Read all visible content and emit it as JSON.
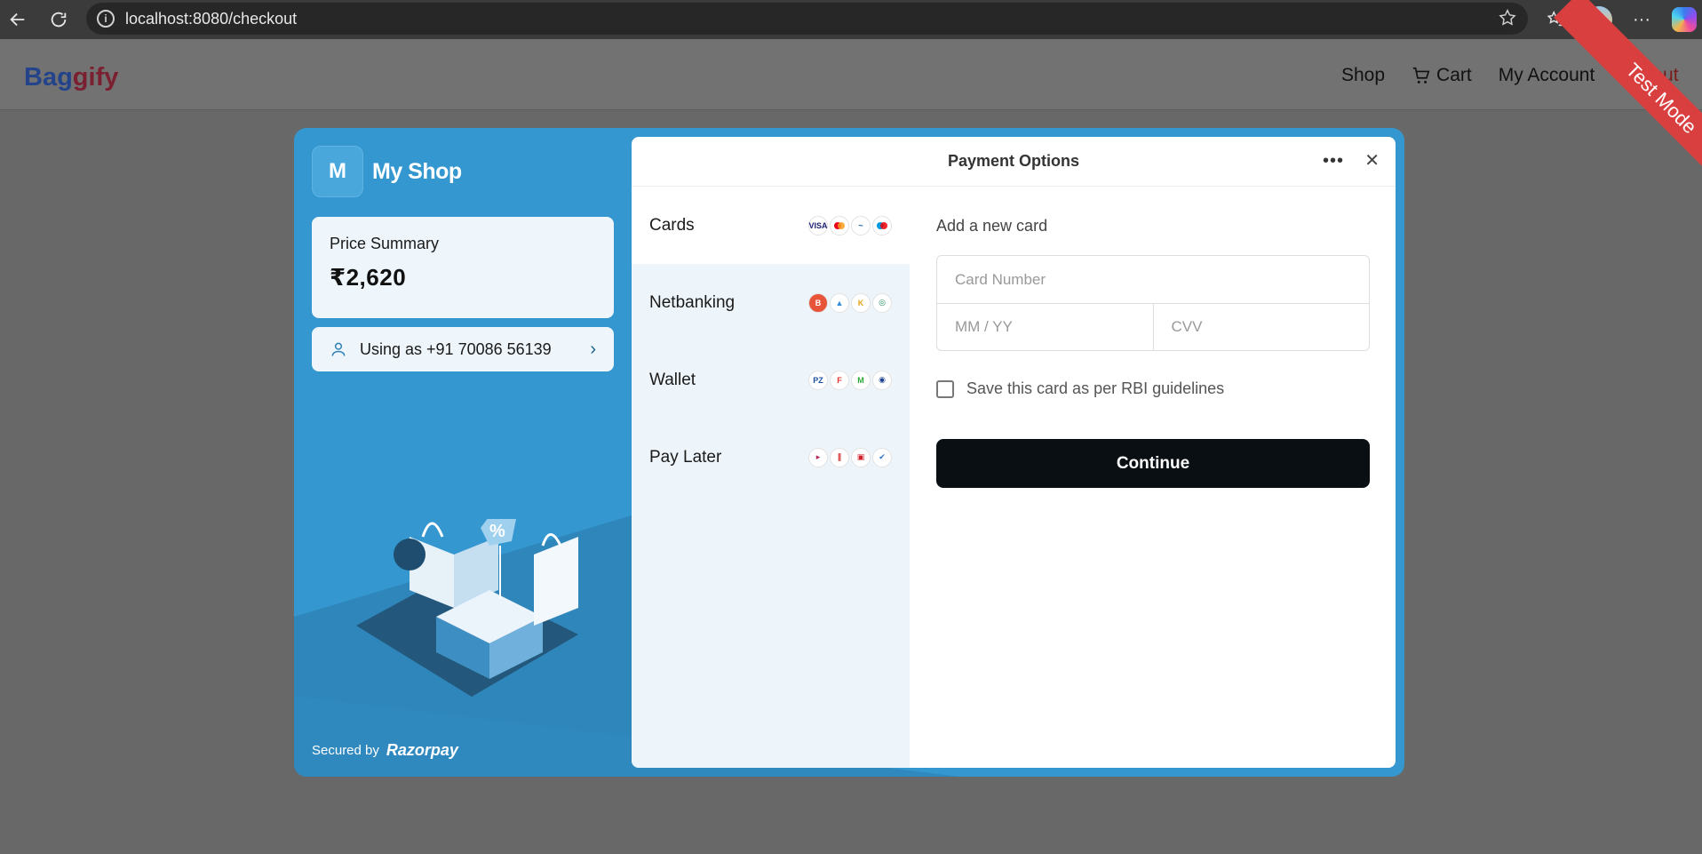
{
  "browser": {
    "url": "localhost:8080/checkout",
    "icons": [
      "back-icon",
      "reload-icon",
      "info-icon",
      "star-icon",
      "favorites-icon",
      "profile-avatar",
      "more-icon",
      "copilot-icon"
    ]
  },
  "site": {
    "logo_first": "Bag",
    "logo_rest": "gify",
    "nav": {
      "shop": "Shop",
      "cart": "Cart",
      "account": "My Account",
      "logout": "Logout"
    },
    "ribbon": "Test Mode"
  },
  "checkout": {
    "merchant_initial": "M",
    "merchant_name": "My Shop",
    "price_label": "Price Summary",
    "price_amount": "₹2,620",
    "using_as": "Using as +91 70086 56139",
    "secured_by": "Secured by",
    "provider": "Razorpay",
    "panel_title": "Payment Options",
    "methods": [
      {
        "label": "Cards",
        "logos": [
          "VISA",
          "MC",
          "RuPay",
          "Maestro"
        ]
      },
      {
        "label": "Netbanking",
        "logos": [
          "B",
          "A",
          "K",
          "I"
        ]
      },
      {
        "label": "Wallet",
        "logos": [
          "PZ",
          "FC",
          "M",
          "P"
        ]
      },
      {
        "label": "Pay Later",
        "logos": [
          "L",
          "S",
          "H",
          "Z"
        ]
      }
    ],
    "form": {
      "heading": "Add a new card",
      "card_number_placeholder": "Card Number",
      "expiry_placeholder": "MM / YY",
      "cvv_placeholder": "CVV",
      "save_label": "Save this card as per RBI guidelines",
      "continue_label": "Continue"
    }
  },
  "colors": {
    "modal_blue": "#3497cf",
    "button_dark": "#0a0f14",
    "ribbon_red": "#d93f3f"
  }
}
